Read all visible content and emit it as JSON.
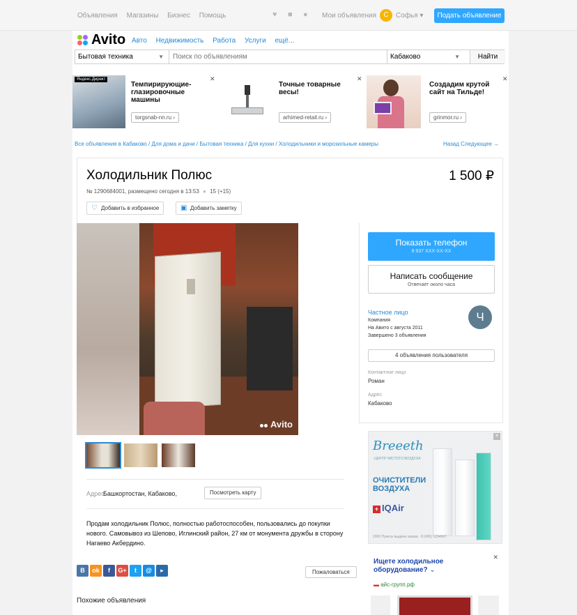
{
  "topbar": {
    "nav": [
      "Объявления",
      "Магазины",
      "Бизнес",
      "Помощь"
    ],
    "my_ads": "Мои объявления",
    "avatar_letter": "С",
    "user_name": "Софья",
    "post_button": "Подать объявление"
  },
  "header": {
    "logo": "Avito",
    "nav": [
      "Авто",
      "Недвижимость",
      "Работа",
      "Услуги",
      "ещё..."
    ]
  },
  "search": {
    "category": "Бытовая техника",
    "placeholder": "Поиск по объявлениям",
    "location": "Кабаково",
    "button": "Найти"
  },
  "ads": [
    {
      "badge": "Яндекс.Директ",
      "title": "Темпирирующие-глазировочные машины",
      "link": "torgsnab-nn.ru ›"
    },
    {
      "title": "Точные товарные весы!",
      "link": "arhimed-retail.ru ›"
    },
    {
      "title": "Создадим крутой сайт на Тильде!",
      "link": "grinmor.ru ›"
    }
  ],
  "breadcrumbs": "Все объявления в Кабаково / Для дома и дачи / Бытовая техника / Для кухни / Холодильники и морозильные камеры",
  "nav_links": "Назад   Следующее →",
  "listing": {
    "title": "Холодильник Полюс",
    "price": "1 500 ₽",
    "meta": "№ 1290684001, размещено сегодня в 13:53",
    "views": "15 (+15)",
    "favorite_button": "Добавить в избранное",
    "note_button": "Добавить заметку",
    "watermark": "Avito",
    "address_label": "Адрес:",
    "address": "Башкортостан, Кабаково,",
    "map_button": "Посмотреть карту",
    "description": "Продам холодильник Полюс, полностью работоспособен, пользовались до покупки нового. Самовывоз из Шепово, Иглинский район, 27 км от монумента дружбы в сторону Нагаево Акбердино.",
    "complain_button": "Пожаловаться",
    "similar_heading": "Похожие объявления"
  },
  "social": [
    {
      "label": "В",
      "color": "#4a76a8"
    },
    {
      "label": "ok",
      "color": "#f7931e"
    },
    {
      "label": "f",
      "color": "#3b5998"
    },
    {
      "label": "G+",
      "color": "#dc4e41"
    },
    {
      "label": "t",
      "color": "#1da1f2"
    },
    {
      "label": "@",
      "color": "#168de2"
    },
    {
      "label": "▸",
      "color": "#2a6aa8"
    }
  ],
  "seller": {
    "phone_button": "Показать телефон",
    "phone_number": "8 937 XXX-XX-XX",
    "message_button": "Написать сообщение",
    "response_time": "Отвечает около часа",
    "type": "Частное лицо",
    "name_line": "Компания",
    "since": "На Авито с августа 2011",
    "completed": "Завершено 3 объявления",
    "avatar_letter": "Ч",
    "user_ads_button": "4 объявления пользователя",
    "contact_label": "Контактное лицо",
    "contact_name": "Роман",
    "address_label": "Адрес",
    "address": "Кабаково"
  },
  "banner_breeze": {
    "brand": "Breeeth",
    "tagline": "ЦЕНТР ЧИСТОГО ВОЗДУХА",
    "headline_1": "ОЧИСТИТЕЛИ",
    "headline_2": "ВОЗДУХА",
    "partner": "IQAir",
    "footer": "2000 Пункты выдачи заказа · 8 (495) 1234567"
  },
  "banner_cold": {
    "title": "Ищете холодильное оборудование?",
    "site": "айс-групп.рф"
  },
  "colors": {
    "accent_blue": "#2fa7ff",
    "link_blue": "#2a8ad4",
    "avatar_orange": "#f7b500"
  }
}
